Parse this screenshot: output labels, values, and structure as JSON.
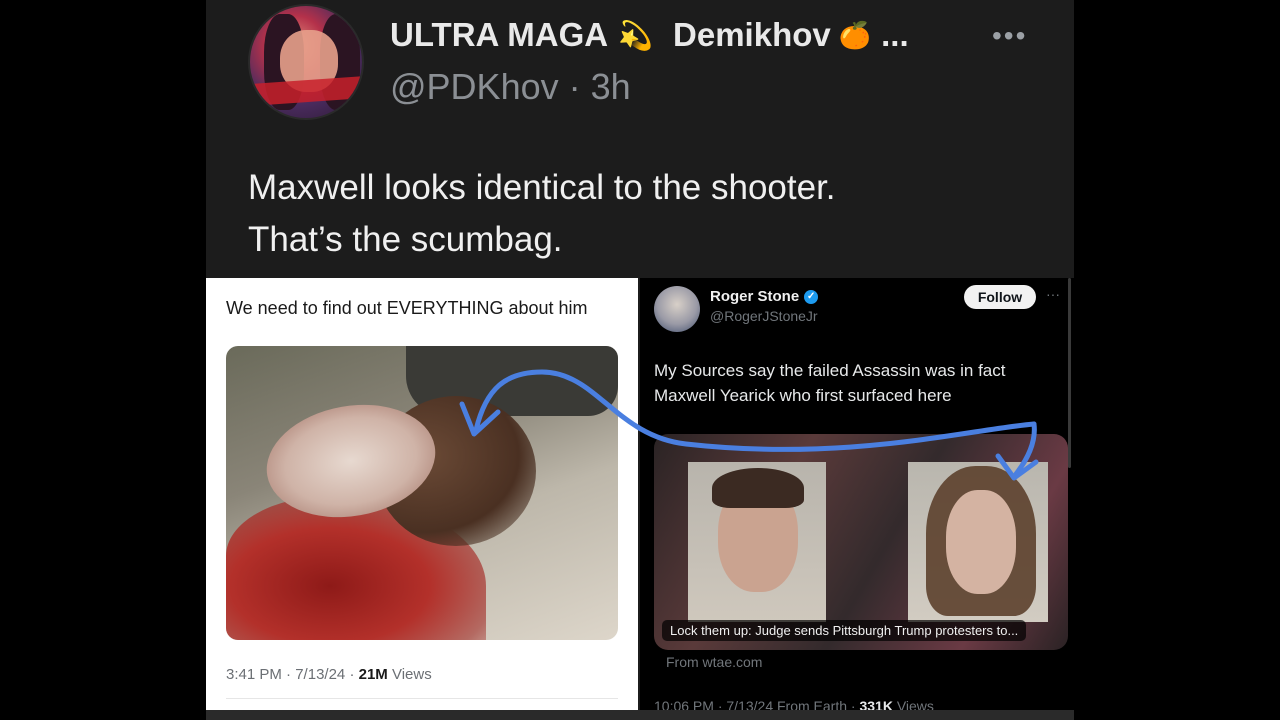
{
  "tweet": {
    "display_name": "ULTRA MAGA",
    "name_emoji_1": "💫",
    "secondary_name": "Demikhov",
    "name_emoji_2": "🍊",
    "name_overflow": "...",
    "handle": "@PDKhov",
    "separator": "·",
    "time": "3h",
    "more_label": "•••",
    "text_line_1": "Maxwell looks identical to the shooter.",
    "text_line_2": "That’s the scumbag."
  },
  "left_post": {
    "caption": "We need to find out EVERYTHING about him",
    "time": "3:41 PM",
    "date": "7/13/24",
    "views_count": "21M",
    "views_label": "Views",
    "separator": "·"
  },
  "right_post": {
    "author_name": "Roger Stone",
    "verified_mark": "✓",
    "author_handle": "@RogerJStoneJr",
    "follow_label": "Follow",
    "more_label": "···",
    "text": "My Sources say the failed Assassin was in fact Maxwell Yearick who first surfaced here",
    "card_title": "Lock them up: Judge sends Pittsburgh Trump protesters to...",
    "card_source": "From wtae.com",
    "meta_time": "10:06 PM",
    "meta_date": "7/13/24",
    "meta_origin": "From Earth",
    "views_count": "331K",
    "views_label": "Views",
    "separator": "·"
  },
  "colors": {
    "arrow": "#4a7fe0",
    "verified": "#1d9bf0"
  }
}
